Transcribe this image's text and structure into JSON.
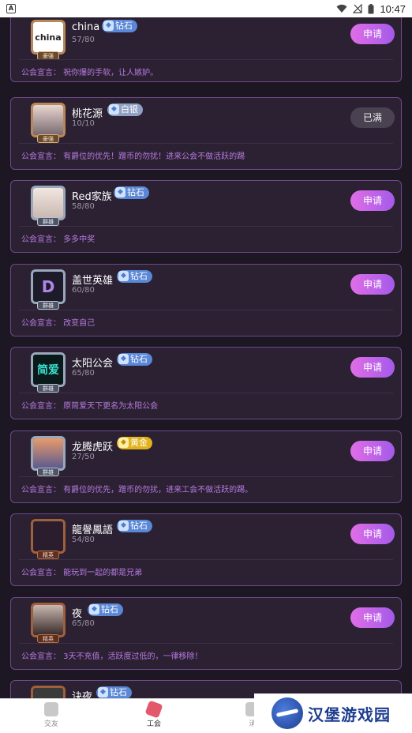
{
  "status_bar": {
    "app_letter": "A",
    "time": "10:47"
  },
  "guilds": [
    {
      "name": "china",
      "rank": "钻石",
      "rank_type": "diamond",
      "count": "57/80",
      "action": "申请",
      "motto": "公会宣言：  祝你爆的手软，让人嫉妒。",
      "avatar_text": "china",
      "badge": "豪强",
      "frame": "gold"
    },
    {
      "name": "桃花源",
      "rank": "白银",
      "rank_type": "silver",
      "count": "10/10",
      "action": "已满",
      "motto": "公会宣言：  有爵位的优先！蹭币的勿扰！进来公会不做活跃的踢",
      "avatar_text": "",
      "badge": "豪强",
      "frame": "gold"
    },
    {
      "name": "Red家族",
      "rank": "钻石",
      "rank_type": "diamond",
      "count": "58/80",
      "action": "申请",
      "motto": "公会宣言：  多多中奖",
      "avatar_text": "",
      "badge": "群雄",
      "frame": "silver"
    },
    {
      "name": "盖世英雄",
      "rank": "钻石",
      "rank_type": "diamond",
      "count": "60/80",
      "action": "申请",
      "motto": "公会宣言：  改变自己",
      "avatar_text": "D",
      "badge": "群雄",
      "frame": "silver"
    },
    {
      "name": "太阳公会",
      "rank": "钻石",
      "rank_type": "diamond",
      "count": "65/80",
      "action": "申请",
      "motto": "公会宣言：  原简爱天下更名为太阳公会",
      "avatar_text": "简爱",
      "badge": "群雄",
      "frame": "silver"
    },
    {
      "name": "龙腾虎跃",
      "rank": "黄金",
      "rank_type": "gold",
      "count": "27/50",
      "action": "申请",
      "motto": "公会宣言：  有爵位的优先，蹭币的勿扰，进来工会不做活跃的踢。",
      "avatar_text": "",
      "badge": "群雄",
      "frame": "silver"
    },
    {
      "name": "龍譽鳳語",
      "rank": "钻石",
      "rank_type": "diamond",
      "count": "54/80",
      "action": "申请",
      "motto": "公会宣言：  能玩到一起的都是兄弟",
      "avatar_text": "",
      "badge": "精英",
      "frame": "copper"
    },
    {
      "name": "夜",
      "rank": "钻石",
      "rank_type": "diamond",
      "count": "65/80",
      "action": "申请",
      "motto": "公会宣言：  3天不充值，活跃度过低的，一律移除！",
      "avatar_text": "",
      "badge": "精英",
      "frame": "copper"
    },
    {
      "name": "诀夜",
      "rank": "钻石",
      "rank_type": "diamond",
      "count": "",
      "action": "",
      "motto": "",
      "avatar_text": "",
      "badge": "",
      "frame": "copper"
    }
  ],
  "tabs": [
    {
      "label": "交友",
      "active": false
    },
    {
      "label": "工会",
      "active": true
    },
    {
      "label": "消",
      "active": false
    }
  ],
  "watermark": {
    "text": "汉堡游戏园"
  }
}
